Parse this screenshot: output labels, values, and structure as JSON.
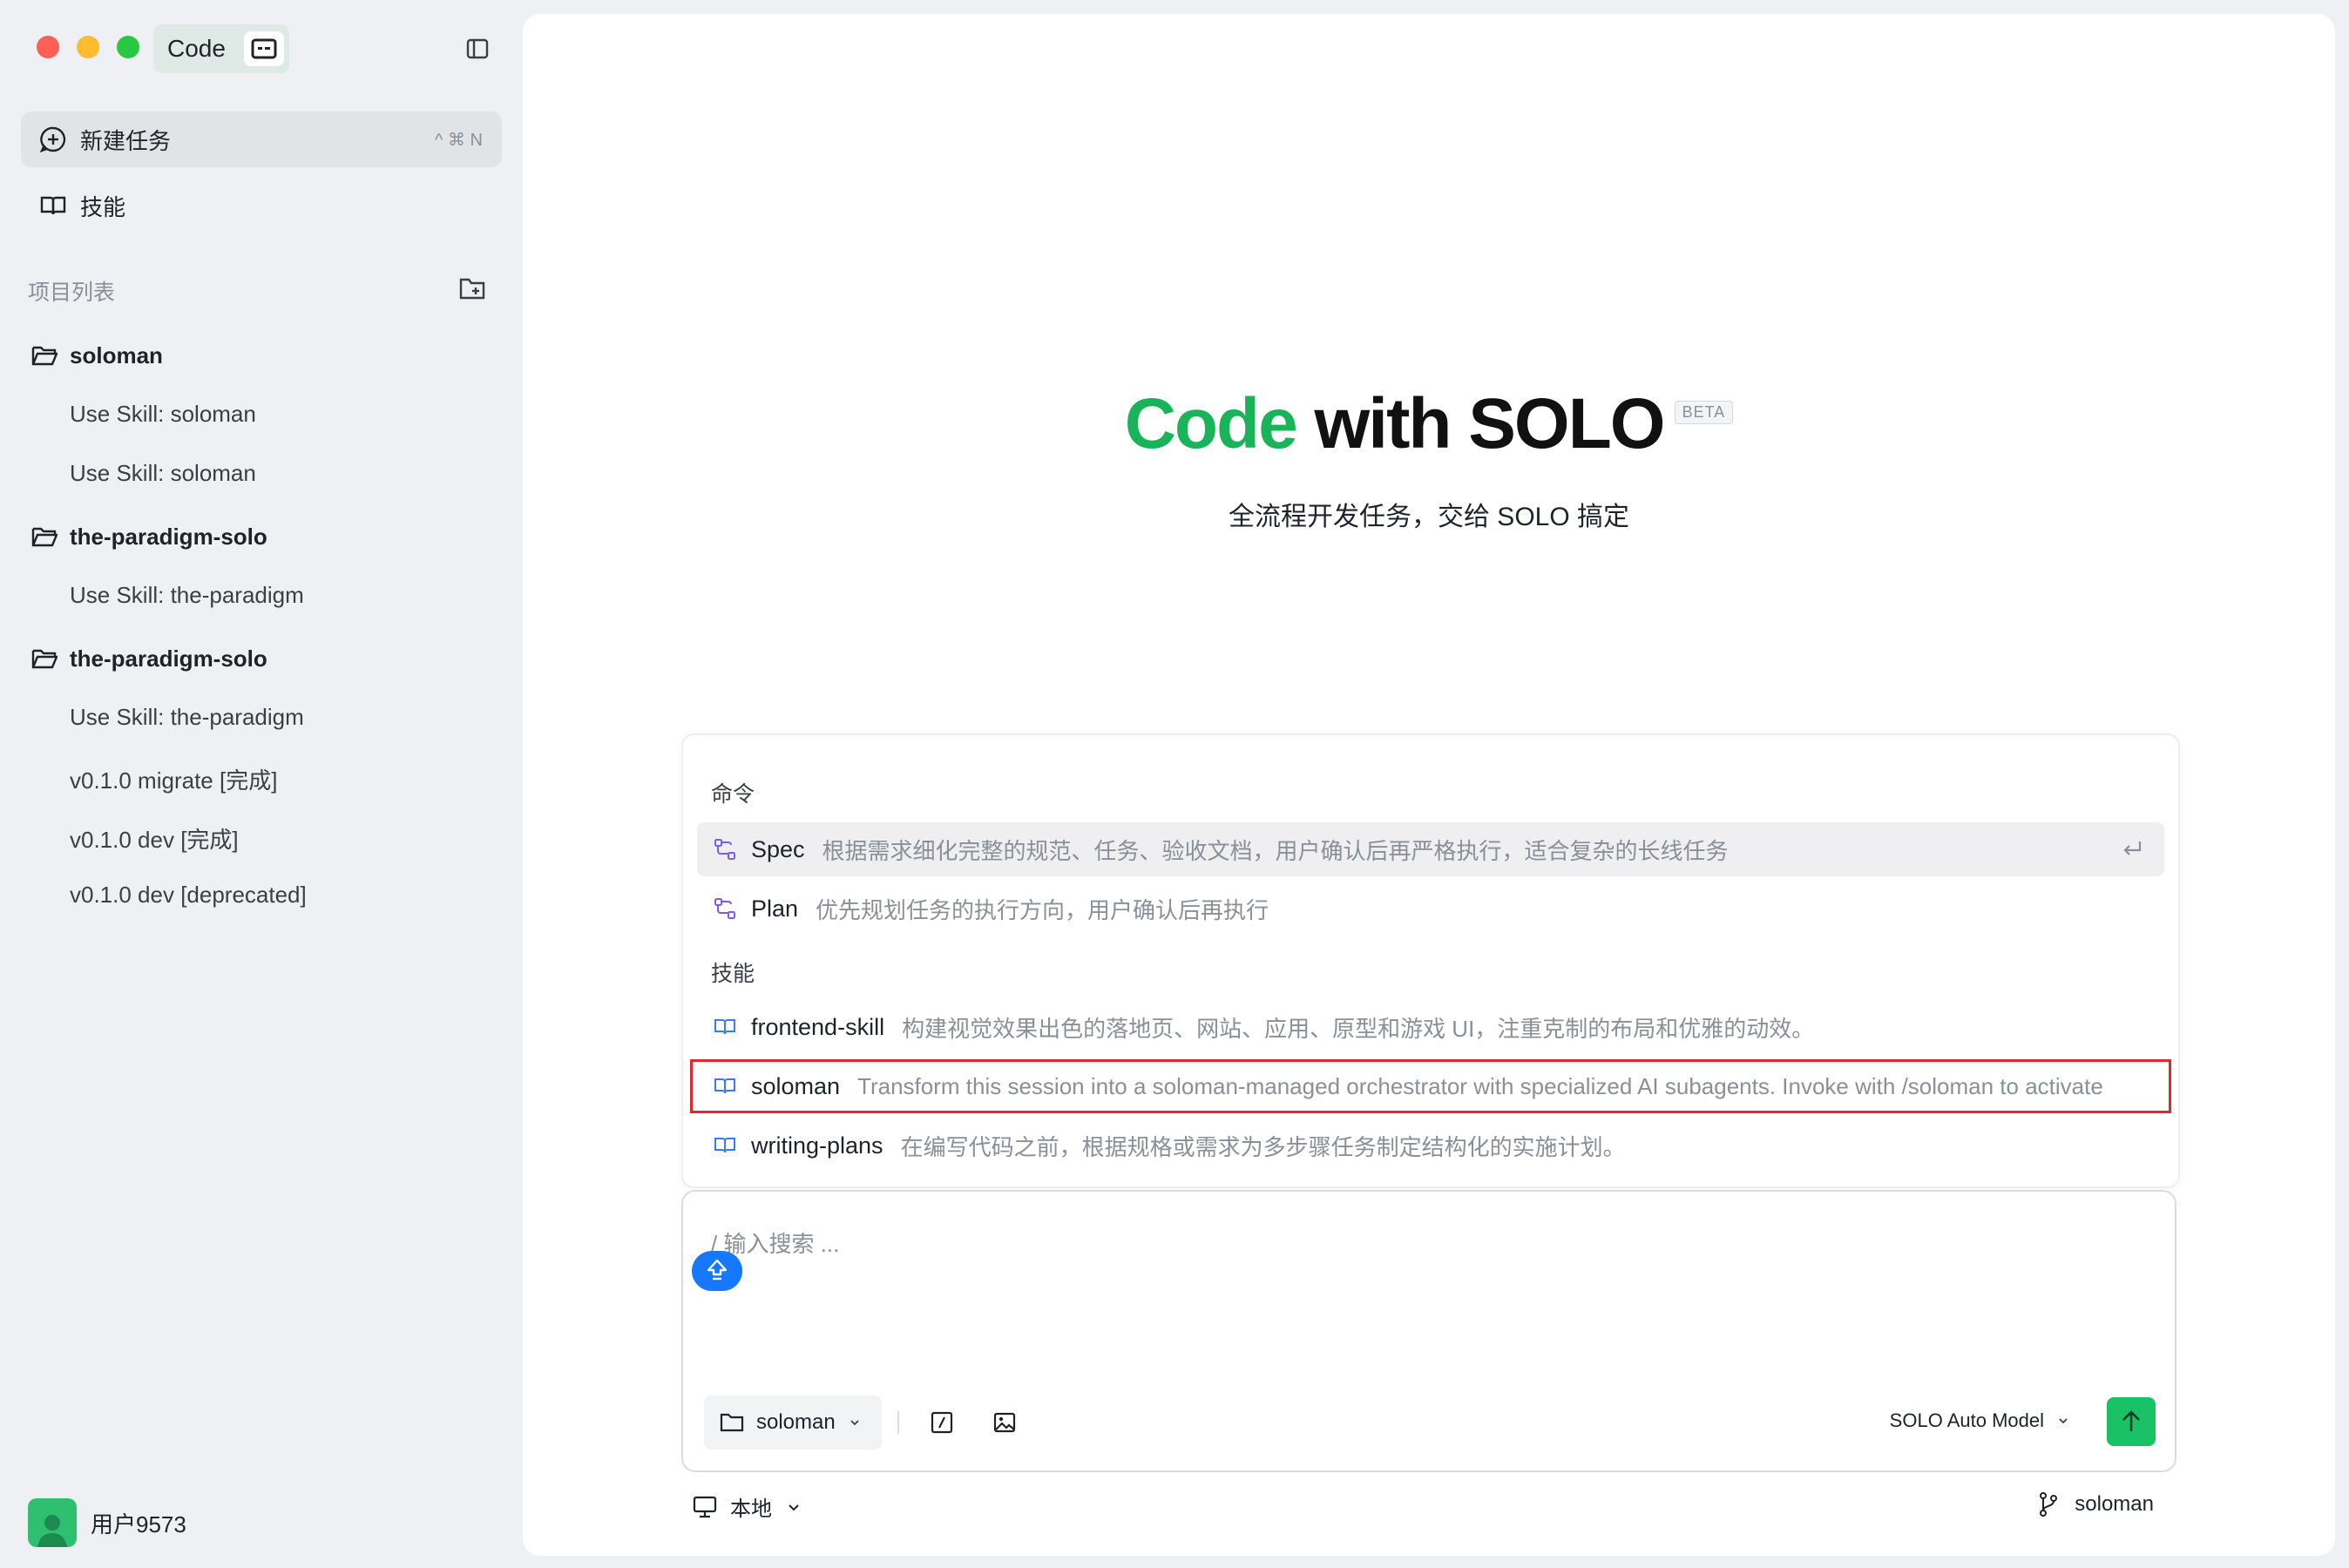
{
  "window": {
    "app_tab_label": "Code"
  },
  "sidebar": {
    "new_task": {
      "label": "新建任务",
      "shortcut": "^ ⌘ N"
    },
    "skills": {
      "label": "技能"
    },
    "projects_title": "项目列表",
    "projects": [
      {
        "name": "soloman",
        "tasks": [
          "Use Skill: soloman",
          "Use Skill: soloman"
        ]
      },
      {
        "name": "the-paradigm-solo",
        "tasks": [
          "Use Skill: the-paradigm"
        ]
      },
      {
        "name": "the-paradigm-solo",
        "tasks": [
          "Use Skill: the-paradigm",
          "v0.1.0 migrate [完成]",
          "v0.1.0 dev [完成]",
          "v0.1.0 dev [deprecated]"
        ]
      }
    ],
    "user": {
      "name": "用户9573"
    }
  },
  "hero": {
    "title_green": "Code",
    "title_dark": "with SOLO",
    "badge": "BETA",
    "subtitle": "全流程开发任务，交给 SOLO 搞定"
  },
  "popup": {
    "commands_label": "命令",
    "commands": [
      {
        "name": "Spec",
        "desc": "根据需求细化完整的规范、任务、验收文档，用户确认后再严格执行，适合复杂的长线任务"
      },
      {
        "name": "Plan",
        "desc": "优先规划任务的执行方向，用户确认后再执行"
      }
    ],
    "skills_label": "技能",
    "skills": [
      {
        "name": "frontend-skill",
        "desc": "构建视觉效果出色的落地页、网站、应用、原型和游戏 UI，注重克制的布局和优雅的动效。"
      },
      {
        "name": "soloman",
        "desc": "Transform this session into a soloman-managed orchestrator with specialized AI subagents. Invoke with /soloman to activate"
      },
      {
        "name": "writing-plans",
        "desc": "在编写代码之前，根据规格或需求为多步骤任务制定结构化的实施计划。"
      }
    ]
  },
  "input": {
    "placeholder": "/ 输入搜索 ...",
    "project": "soloman",
    "model": "SOLO Auto Model"
  },
  "footer": {
    "env": "本地",
    "branch": "soloman"
  },
  "colors": {
    "accent_green": "#19b35a",
    "send_green": "#19c265",
    "highlight_red": "#e0282e",
    "cursor_blue": "#1677ff"
  }
}
